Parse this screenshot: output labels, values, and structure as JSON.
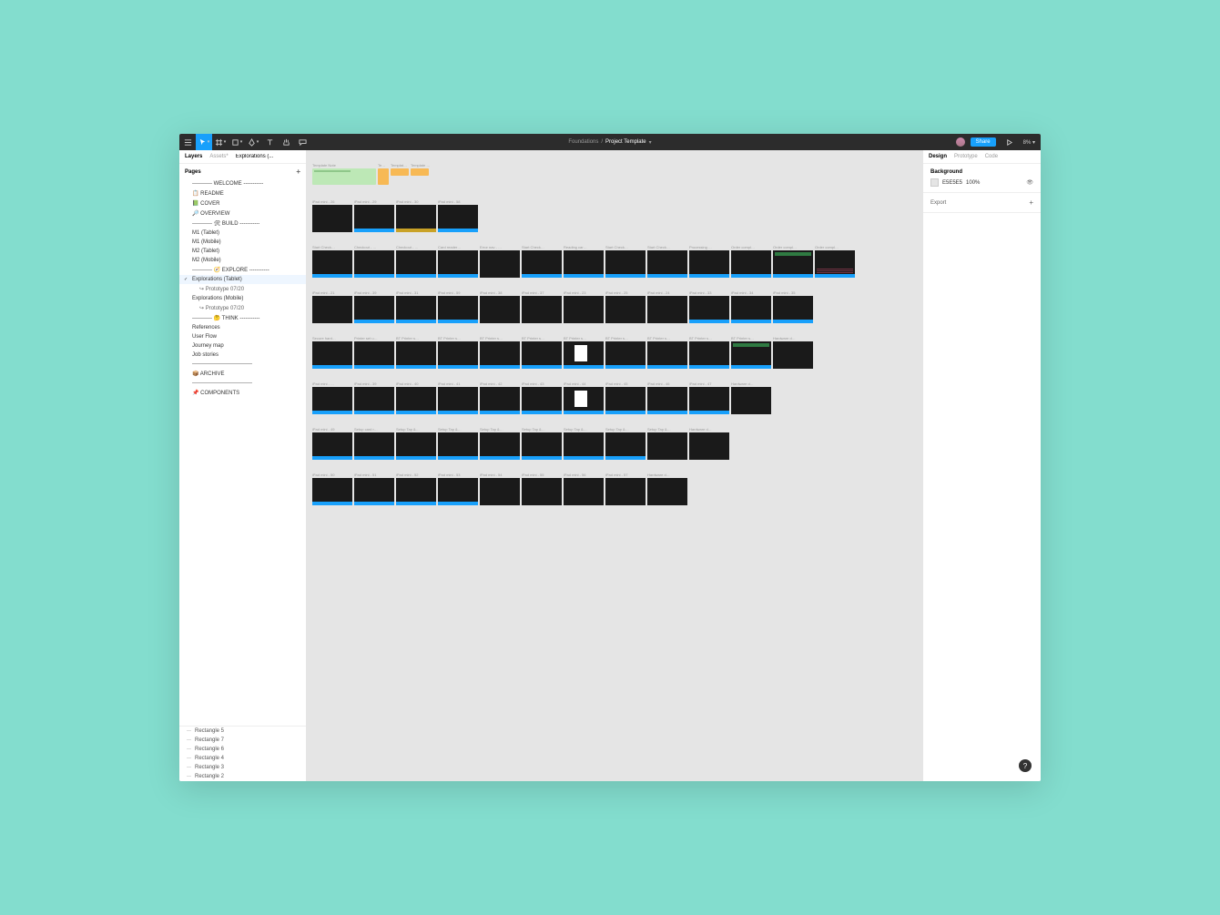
{
  "toolbar": {
    "share": "Share",
    "zoom": "8%"
  },
  "breadcrumb": {
    "project": "Foundations",
    "file": "Project Template"
  },
  "left": {
    "tabs": {
      "layers": "Layers",
      "assets": "Assets*",
      "crumb": "Explorations (..."
    },
    "pages_header": "Pages",
    "pages": [
      {
        "label": "----------- WELCOME -----------"
      },
      {
        "label": "📋 README"
      },
      {
        "label": "📗 COVER"
      },
      {
        "label": "🔎 OVERVIEW"
      },
      {
        "label": "----------- 🛠 BUILD -----------"
      },
      {
        "label": "M1 (Tablet)"
      },
      {
        "label": "M1 (Mobile)"
      },
      {
        "label": "M2 (Tablet)"
      },
      {
        "label": "M2 (Mobile)"
      },
      {
        "label": "----------- 🧭 EXPLORE -----------"
      },
      {
        "label": "Explorations (Tablet)",
        "selected": true
      },
      {
        "label": "↪ Prototype 07/20",
        "sub": true
      },
      {
        "label": "Explorations (Mobile)"
      },
      {
        "label": "↪ Prototype 07/20",
        "sub": true
      },
      {
        "label": "----------- 🤔 THINK -----------"
      },
      {
        "label": "References"
      },
      {
        "label": "User Flow"
      },
      {
        "label": "Journey map"
      },
      {
        "label": "Job stories"
      },
      {
        "label": "---------------------------------"
      },
      {
        "label": "📦 ARCHIVE"
      },
      {
        "label": "---------------------------------"
      },
      {
        "label": "📌 COMPONENTS"
      }
    ],
    "layers": [
      "Rectangle 5",
      "Rectangle 7",
      "Rectangle 6",
      "Rectangle 4",
      "Rectangle 3",
      "Rectangle 2"
    ]
  },
  "canvas": {
    "notes": [
      {
        "label": "Template Note",
        "cls": "green"
      },
      {
        "label": "Te…",
        "cls": "orange"
      },
      {
        "label": "Templat…",
        "cls": "orange2"
      },
      {
        "label": "Template …",
        "cls": "orange2"
      }
    ],
    "rows": [
      [
        {
          "l": "iPad mini - 26",
          "v": "nobar"
        },
        {
          "l": "iPad mini - 29",
          "v": ""
        },
        {
          "l": "iPad mini - 30",
          "v": "yellow"
        },
        {
          "l": "iPad mini - 58",
          "v": ""
        }
      ],
      [
        {
          "l": "Start Check…",
          "v": ""
        },
        {
          "l": "Checkout - …",
          "v": ""
        },
        {
          "l": "Checkout - …",
          "v": ""
        },
        {
          "l": "Card reader…",
          "v": ""
        },
        {
          "l": "Error nav - …",
          "v": "nobar"
        },
        {
          "l": "Start Check…",
          "v": ""
        },
        {
          "l": "Reading car…",
          "v": ""
        },
        {
          "l": "Start Check…",
          "v": ""
        },
        {
          "l": "Start Check…",
          "v": ""
        },
        {
          "l": "Processing …",
          "v": ""
        },
        {
          "l": "Order compl…",
          "v": ""
        },
        {
          "l": "Order compl…",
          "v": "green-accent"
        },
        {
          "l": "Order compl…",
          "v": "hatch"
        }
      ],
      [
        {
          "l": "iPad mini - 21",
          "v": "nobar"
        },
        {
          "l": "iPad mini - 39",
          "v": ""
        },
        {
          "l": "iPad mini - 31",
          "v": ""
        },
        {
          "l": "iPad mini - 59",
          "v": ""
        },
        {
          "l": "iPad mini - 38",
          "v": "nobar"
        },
        {
          "l": "iPad mini - 37",
          "v": "nobar"
        },
        {
          "l": "iPad mini - 23",
          "v": "nobar"
        },
        {
          "l": "iPad mini - 25",
          "v": "nobar"
        },
        {
          "l": "iPad mini - 24",
          "v": "nobar"
        },
        {
          "l": "iPad mini - 33",
          "v": ""
        },
        {
          "l": "iPad mini - 34",
          "v": ""
        },
        {
          "l": "iPad mini - 35",
          "v": ""
        }
      ],
      [
        {
          "l": "Secure hard…",
          "v": ""
        },
        {
          "l": "Printer set u…",
          "v": ""
        },
        {
          "l": "BT Printer s…",
          "v": ""
        },
        {
          "l": "BT Printer s…",
          "v": ""
        },
        {
          "l": "BT Printer s…",
          "v": ""
        },
        {
          "l": "BT Printer s…",
          "v": ""
        },
        {
          "l": "BT Printer s…",
          "v": "white-sq"
        },
        {
          "l": "BT Printer s…",
          "v": ""
        },
        {
          "l": "BT Printer s…",
          "v": ""
        },
        {
          "l": "BT Printer s…",
          "v": ""
        },
        {
          "l": "BT Printer s…",
          "v": "green-accent"
        },
        {
          "l": "Hardware d…",
          "v": "nobar"
        }
      ],
      [
        {
          "l": "iPad mini - …",
          "v": ""
        },
        {
          "l": "iPad mini - 39",
          "v": ""
        },
        {
          "l": "iPad mini - 40",
          "v": ""
        },
        {
          "l": "iPad mini - 41",
          "v": ""
        },
        {
          "l": "iPad mini - 42",
          "v": ""
        },
        {
          "l": "iPad mini - 43",
          "v": ""
        },
        {
          "l": "iPad mini - 44",
          "v": "white-sq"
        },
        {
          "l": "iPad mini - 45",
          "v": ""
        },
        {
          "l": "iPad mini - 46",
          "v": ""
        },
        {
          "l": "iPad mini - 47",
          "v": ""
        },
        {
          "l": "Hardware d…",
          "v": "nobar"
        }
      ],
      [
        {
          "l": "iPad mini - 49",
          "v": ""
        },
        {
          "l": "Setup card r…",
          "v": ""
        },
        {
          "l": "Setup Tap &…",
          "v": ""
        },
        {
          "l": "Setup Tap &…",
          "v": ""
        },
        {
          "l": "Setup Tap &…",
          "v": ""
        },
        {
          "l": "Setup Tap &…",
          "v": ""
        },
        {
          "l": "Setup Tap &…",
          "v": ""
        },
        {
          "l": "Setup Tap &…",
          "v": ""
        },
        {
          "l": "Setup Tap &…",
          "v": "nobar"
        },
        {
          "l": "Hardware d…",
          "v": "nobar"
        }
      ],
      [
        {
          "l": "iPad mini - 50",
          "v": ""
        },
        {
          "l": "iPad mini - 51",
          "v": ""
        },
        {
          "l": "iPad mini - 52",
          "v": ""
        },
        {
          "l": "iPad mini - 53",
          "v": ""
        },
        {
          "l": "iPad mini - 54",
          "v": "nobar"
        },
        {
          "l": "iPad mini - 55",
          "v": "nobar"
        },
        {
          "l": "iPad mini - 56",
          "v": "nobar"
        },
        {
          "l": "iPad mini - 57",
          "v": "nobar"
        },
        {
          "l": "Hardware d…",
          "v": "nobar"
        }
      ]
    ]
  },
  "right": {
    "tabs": {
      "design": "Design",
      "prototype": "Prototype",
      "code": "Code"
    },
    "background": {
      "hdr": "Background",
      "hex": "E5E5E5",
      "opacity": "100%"
    },
    "export": "Export"
  },
  "help": "?"
}
